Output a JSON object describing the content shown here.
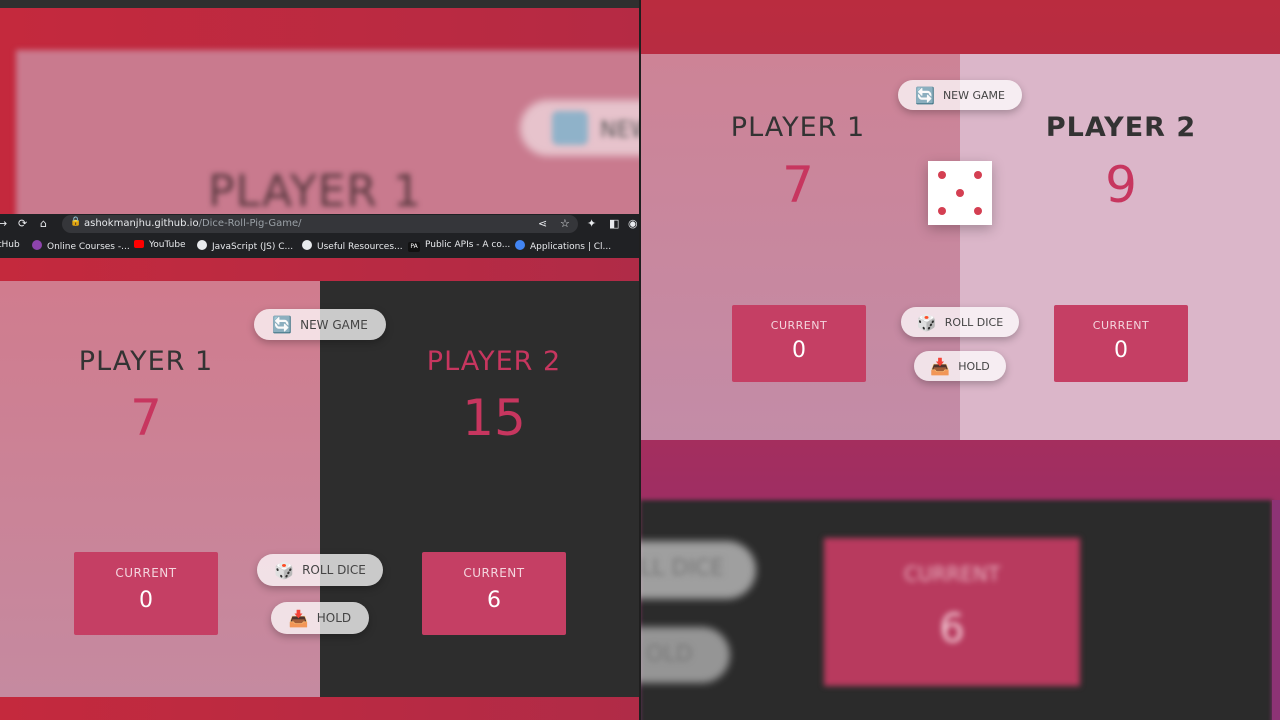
{
  "blurred_top": {
    "button_label": "NEW",
    "title": "PLAYER 1"
  },
  "browser": {
    "url_host": "ashokmanjhu.github.io",
    "url_path": "/Dice-Roll-Pig-Game/",
    "bookmarks": [
      {
        "label": "tHub",
        "icon": "github-icon",
        "color": "#e8eaed"
      },
      {
        "label": "Online Courses -...",
        "icon": "courses-icon",
        "color": "#8e44ad"
      },
      {
        "label": "YouTube",
        "icon": "youtube-icon",
        "color": "#ff0000"
      },
      {
        "label": "JavaScript (JS) C...",
        "icon": "globe-icon",
        "color": "#e8eaed"
      },
      {
        "label": "Useful Resources...",
        "icon": "globe-icon",
        "color": "#e8eaed"
      },
      {
        "label": "Public APIs - A co...",
        "icon": "pa-icon",
        "color": "#111111"
      },
      {
        "label": "Applications | Cl...",
        "icon": "apps-icon",
        "color": "#4285f4"
      }
    ],
    "pa_badge": "PA"
  },
  "game_left": {
    "new_game": "NEW GAME",
    "roll_dice": "ROLL DICE",
    "hold": "HOLD",
    "player1": {
      "name": "PLAYER 1",
      "score": "7",
      "current_label": "CURRENT",
      "current": "0"
    },
    "player2": {
      "name": "PLAYER 2",
      "score": "15",
      "current_label": "CURRENT",
      "current": "6"
    }
  },
  "game_right": {
    "new_game": "NEW GAME",
    "roll_dice": "ROLL DICE",
    "hold": "HOLD",
    "dice_value": 5,
    "player1": {
      "name": "PLAYER 1",
      "score": "7",
      "current_label": "CURRENT",
      "current": "0"
    },
    "player2": {
      "name": "PLAYER 2",
      "score": "9",
      "current_label": "CURRENT",
      "current": "0"
    }
  },
  "blurred_bottom": {
    "roll_fragment": "LL DICE",
    "hold_fragment": "OLD",
    "current_label": "CURRENT",
    "current_value": "6"
  },
  "colors": {
    "accent": "#c7365f",
    "current_box": "#c53f64",
    "dice_dot": "#d43f52"
  },
  "icons": {
    "new_game": "🔄",
    "roll_dice": "🎲",
    "hold": "📥"
  }
}
